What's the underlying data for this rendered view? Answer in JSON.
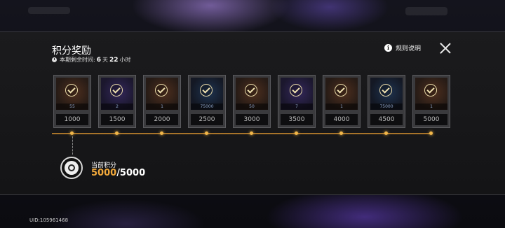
{
  "header": {
    "title": "积分奖励",
    "timer_label": "本期剩余时间:",
    "days": "6",
    "days_unit": "天",
    "hours": "22",
    "hours_unit": "小时",
    "rules_label": "规则说明"
  },
  "rewards": [
    {
      "qty": "55",
      "points": "1000",
      "art": "brown"
    },
    {
      "qty": "2",
      "points": "1500",
      "art": "purple"
    },
    {
      "qty": "1",
      "points": "2000",
      "art": "brown"
    },
    {
      "qty": "75000",
      "points": "2500",
      "art": "blue"
    },
    {
      "qty": "50",
      "points": "3000",
      "art": "brown"
    },
    {
      "qty": "7",
      "points": "3500",
      "art": "purple"
    },
    {
      "qty": "1",
      "points": "4000",
      "art": "brown"
    },
    {
      "qty": "75000",
      "points": "4500",
      "art": "blue"
    },
    {
      "qty": "1",
      "points": "5000",
      "art": "brown"
    }
  ],
  "progress": {
    "label": "当前积分",
    "current": "5000",
    "total": "/5000",
    "fraction": 1.0
  },
  "footer": {
    "uid": "UID:105961468"
  },
  "colors": {
    "accent": "#f2a93b",
    "track": "#a8742a"
  }
}
